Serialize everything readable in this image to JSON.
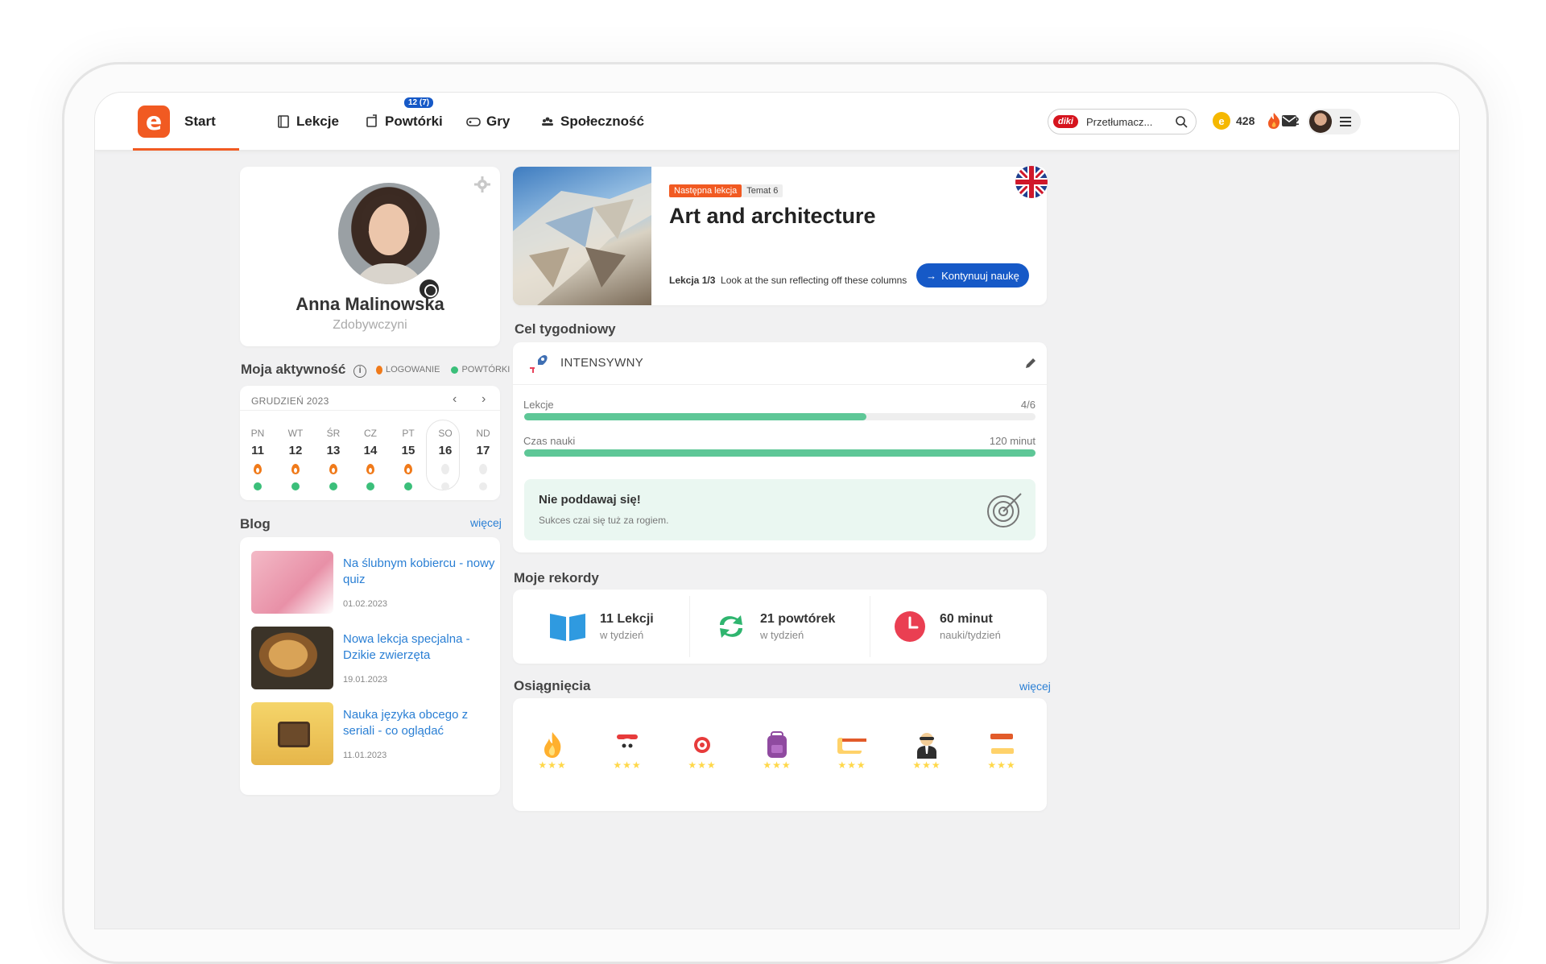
{
  "nav": {
    "items": [
      {
        "label": "Start",
        "icon": "logo-e"
      },
      {
        "label": "Lekcje",
        "icon": "book-icon"
      },
      {
        "label": "Powtórki",
        "icon": "repeat-icon",
        "badge": "12 (7)"
      },
      {
        "label": "Gry",
        "icon": "gamepad-icon"
      },
      {
        "label": "Społeczność",
        "icon": "community-icon"
      }
    ],
    "logo_letter": "e",
    "search": {
      "brand": "diki",
      "placeholder": "Przetłumacz..."
    },
    "coins": "428",
    "streak": "22"
  },
  "profile": {
    "name": "Anna Malinowska",
    "role": "Zdobywczyni"
  },
  "activity": {
    "title": "Moja aktywność",
    "legend_login": "LOGOWANIE",
    "legend_review": "POWTÓRKI",
    "month": "GRUDZIEŃ 2023",
    "days": [
      {
        "name": "PN",
        "date": "11",
        "login": true,
        "review": true
      },
      {
        "name": "WT",
        "date": "12",
        "login": true,
        "review": true
      },
      {
        "name": "ŚR",
        "date": "13",
        "login": true,
        "review": true
      },
      {
        "name": "CZ",
        "date": "14",
        "login": true,
        "review": true
      },
      {
        "name": "PT",
        "date": "15",
        "login": true,
        "review": true
      },
      {
        "name": "SO",
        "date": "16",
        "login": false,
        "review": false
      },
      {
        "name": "ND",
        "date": "17",
        "login": false,
        "review": false
      }
    ]
  },
  "blog": {
    "title": "Blog",
    "more": "więcej",
    "posts": [
      {
        "title": "Na ślubnym kobiercu - nowy quiz",
        "date": "01.02.2023"
      },
      {
        "title": "Nowa lekcja specjalna - Dzikie zwierzęta",
        "date": "19.01.2023"
      },
      {
        "title": "Nauka języka obcego z seriali - co oglądać",
        "date": "11.01.2023"
      }
    ]
  },
  "lesson": {
    "tag_next": "Następna lekcja",
    "tag_topic": "Temat 6",
    "title": "Art and architecture",
    "progress_label": "Lekcja 1/3",
    "description": "Look at the sun reflecting off these columns",
    "button": "Kontynuuj naukę",
    "flag": "uk-flag-icon"
  },
  "weekly_goal": {
    "title": "Cel tygodniowy",
    "level": "INTENSYWNY",
    "lessons_label": "Lekcje",
    "lessons_value": "4/6",
    "lessons_fraction": 0.67,
    "time_label": "Czas nauki",
    "time_value": "120 minut",
    "time_fraction": 1.0,
    "tip_title": "Nie poddawaj się!",
    "tip_text": "Sukces czai się tuż za rogiem."
  },
  "records": {
    "title": "Moje rekordy",
    "items": [
      {
        "value": "11 Lekcji",
        "sub": "w tydzień",
        "icon": "open-book-icon"
      },
      {
        "value": "21 powtórek",
        "sub": "w tydzień",
        "icon": "recycle-icon"
      },
      {
        "value": "60 minut",
        "sub": "nauki/tydzień",
        "icon": "clock-icon"
      }
    ]
  },
  "achievements": {
    "title": "Osiągnięcia",
    "more": "więcej",
    "badges": [
      {
        "icon": "flame-badge-icon",
        "color": "#f05a28"
      },
      {
        "icon": "pirate-badge-icon",
        "color": "#2e2e2e"
      },
      {
        "icon": "target-badge-icon",
        "color": "#9b4fa6"
      },
      {
        "icon": "backpack-badge-icon",
        "color": "#c3c31a"
      },
      {
        "icon": "cards-badge-icon",
        "color": "#f57c28"
      },
      {
        "icon": "agent-badge-icon",
        "color": "#f6a81c"
      },
      {
        "icon": "books-badge-icon",
        "color": "#22a6cf"
      }
    ],
    "star_glyphs": "★★★"
  }
}
